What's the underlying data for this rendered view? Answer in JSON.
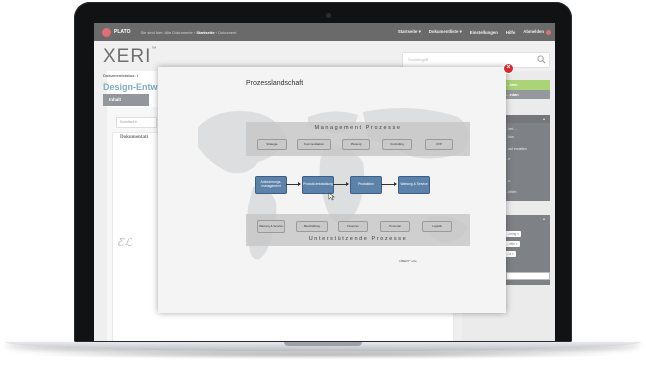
{
  "topbar": {
    "brand": "PLATO",
    "breadcrumb_prefix": "Sie sind hier: Alle Dokumente ›",
    "breadcrumb_current": "Startseite",
    "breadcrumb_suffix": "› Dokument",
    "nav": [
      "Startseite ▾",
      "Dokumentliste ▾",
      "Einstellungen",
      "Hilfe",
      "Abmelden"
    ]
  },
  "header": {
    "logo": "XERI",
    "logo_tm": "™",
    "search_placeholder": "Suchbegriff"
  },
  "document": {
    "status_label": "Dokumentstatus: I",
    "title": "Design-Entw",
    "tab": "Inhalt",
    "format_select": "Schriftart ▾",
    "heading": "Dokumentati",
    "signature": "Ƹℒ"
  },
  "sidebar": {
    "green_button": "…tern",
    "gray_button": "…rdan",
    "box_items": [
      "…tert…",
      "…tion",
      "…auf erstellen",
      "…e",
      "…n",
      "…tellen"
    ],
    "tags": [
      "…ering ×",
      "…eiile ×",
      "…a ×"
    ]
  },
  "modal": {
    "title": "Prozesslandschaft",
    "management_label": "Management Prozesse",
    "management_items": [
      "Strategie",
      "Kommunikation",
      "Planung",
      "Controlling",
      "KVP"
    ],
    "core_items": [
      "Anforderungs-management",
      "Produkt-entwicklung",
      "Produktion",
      "Wartung & Service"
    ],
    "support_items": [
      "Wartung & Service",
      "Beschaffung",
      "Finanzen",
      "Personal",
      "Logistik"
    ],
    "support_label": "Unterstützende Prozesse",
    "footer": "LIBERT° eXe"
  },
  "colors": {
    "accent_blue": "#3b7fa6",
    "core_box": "#5c82aa",
    "green": "#7dbd2e",
    "close": "#d8262f"
  }
}
